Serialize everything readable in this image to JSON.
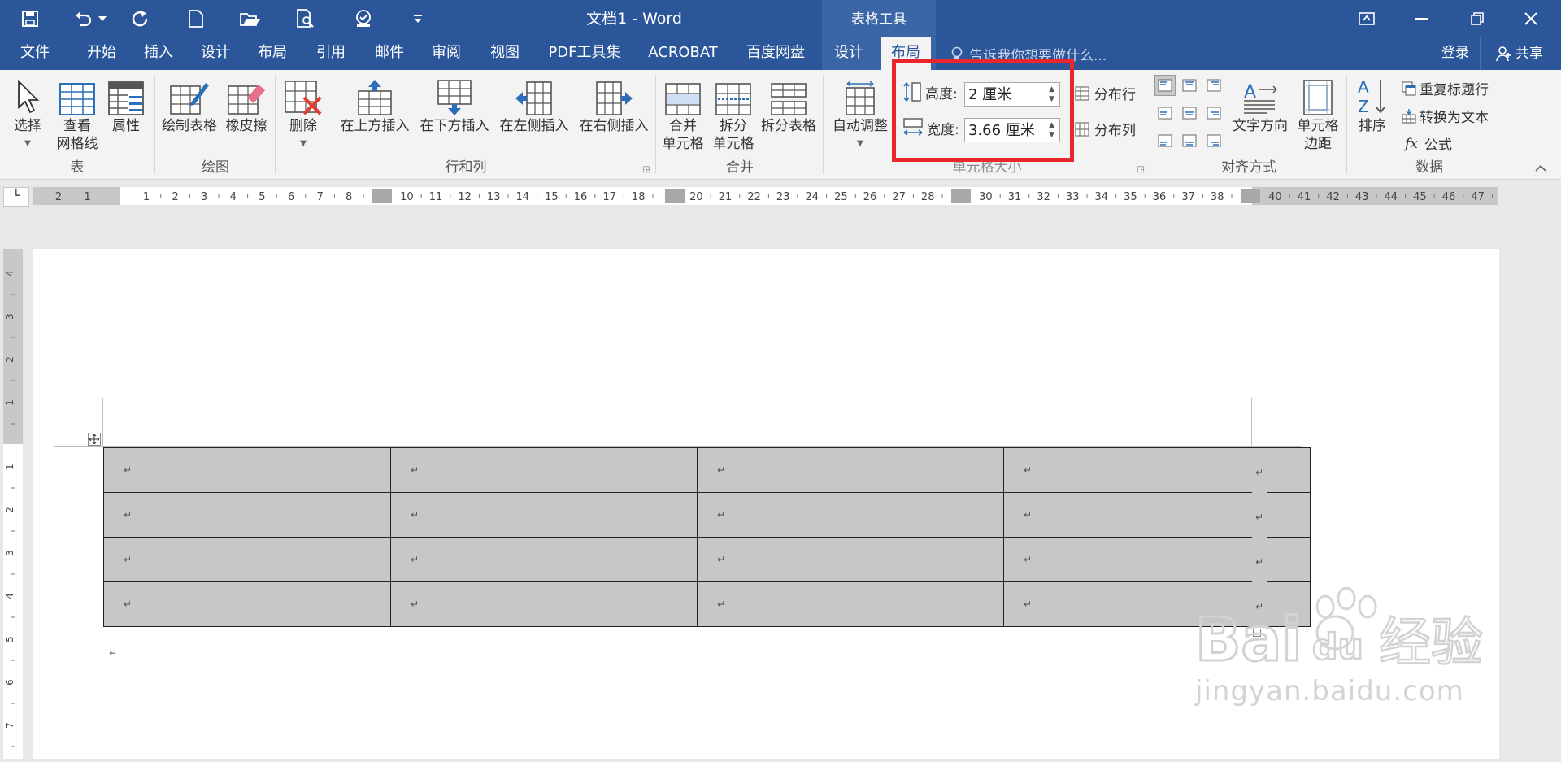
{
  "window": {
    "title": "文档1 - Word",
    "context_tab_group": "表格工具"
  },
  "tabs": [
    {
      "label": "文件"
    },
    {
      "label": "开始"
    },
    {
      "label": "插入"
    },
    {
      "label": "设计"
    },
    {
      "label": "布局"
    },
    {
      "label": "引用"
    },
    {
      "label": "邮件"
    },
    {
      "label": "审阅"
    },
    {
      "label": "视图"
    },
    {
      "label": "PDF工具集"
    },
    {
      "label": "ACROBAT"
    },
    {
      "label": "百度网盘"
    },
    {
      "label": "设计"
    },
    {
      "label": "布局"
    }
  ],
  "tell_me": {
    "placeholder": "告诉我你想要做什么..."
  },
  "account": {
    "login": "登录",
    "share": "共享"
  },
  "ribbon": {
    "table_group": {
      "label": "表",
      "select": "选择",
      "view_gridlines_1": "查看",
      "view_gridlines_2": "网格线",
      "properties": "属性"
    },
    "draw_group": {
      "label": "绘图",
      "draw_table": "绘制表格",
      "eraser": "橡皮擦"
    },
    "rows_cols_group": {
      "label": "行和列",
      "delete": "删除",
      "insert_above": "在上方插入",
      "insert_below": "在下方插入",
      "insert_left": "在左侧插入",
      "insert_right": "在右侧插入"
    },
    "merge_group": {
      "label": "合并",
      "merge_1": "合并",
      "merge_2": "单元格",
      "split_1": "拆分",
      "split_2": "单元格",
      "split_table": "拆分表格"
    },
    "cell_size_group": {
      "label": "单元格大小",
      "autofit": "自动调整",
      "height_label": "高度:",
      "height_value": "2 厘米",
      "width_label": "宽度:",
      "width_value": "3.66 厘米",
      "distribute_rows": "分布行",
      "distribute_cols": "分布列"
    },
    "alignment_group": {
      "label": "对齐方式",
      "text_direction": "文字方向",
      "cell_margins_1": "单元格",
      "cell_margins_2": "边距"
    },
    "data_group": {
      "label": "数据",
      "sort": "排序",
      "repeat_header": "重复标题行",
      "convert_to_text": "转换为文本",
      "formula": "公式"
    }
  },
  "ruler": {
    "h_ticks_left": [
      "2",
      "1"
    ],
    "h_ticks": [
      "1",
      "2",
      "3",
      "4",
      "5",
      "6",
      "7",
      "8",
      "10",
      "11",
      "12",
      "13",
      "14",
      "15",
      "16",
      "17",
      "18",
      "20",
      "21",
      "22",
      "23",
      "24",
      "25",
      "26",
      "27",
      "28",
      "30",
      "31",
      "32",
      "33",
      "34",
      "35",
      "36",
      "37",
      "38",
      "40",
      "41",
      "42",
      "43",
      "44",
      "45",
      "46",
      "47"
    ],
    "v_ticks": [
      "4",
      "3",
      "2",
      "1",
      "1",
      "2",
      "3",
      "4",
      "5",
      "6",
      "7"
    ]
  },
  "table": {
    "rows": 4,
    "cols": 4,
    "cell_mark": "↵"
  },
  "watermark": {
    "brand": "Bai du 经验",
    "url": "jingyan.baidu.com"
  },
  "colors": {
    "title_bar": "#2b579a",
    "context_tab": "#3a66a8",
    "highlight_box": "#e8262b",
    "table_cell_shading": "#c7c7c7"
  }
}
